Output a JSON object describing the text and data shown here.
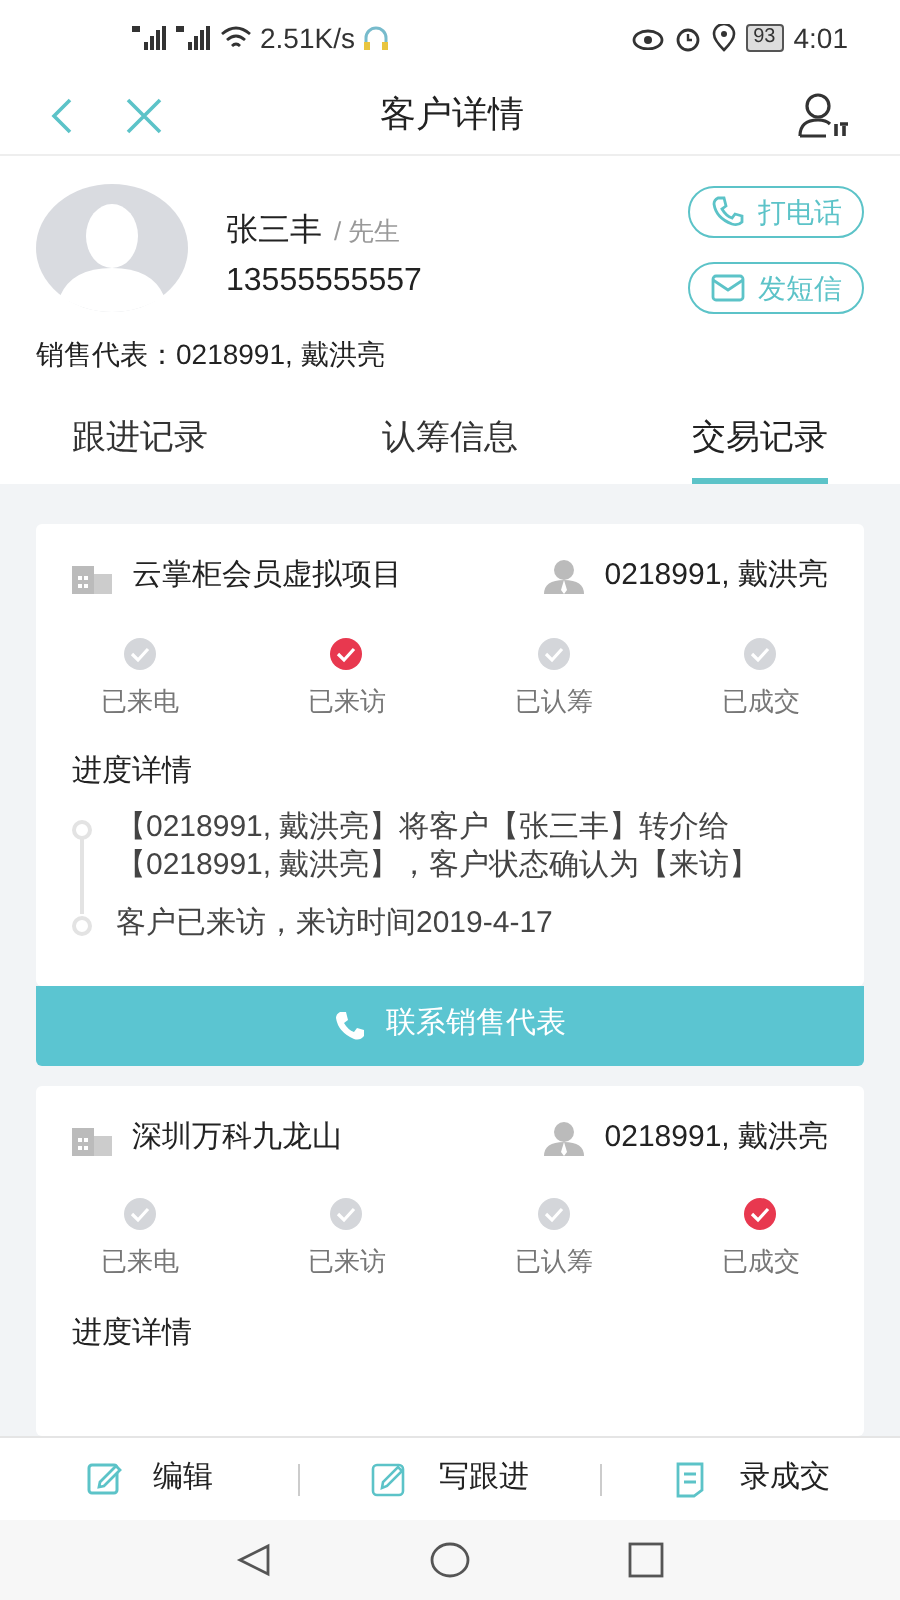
{
  "status_bar": {
    "speed": "2.51K/s",
    "battery": "93",
    "time": "4:01"
  },
  "header": {
    "title": "客户详情"
  },
  "customer": {
    "name": "张三丰",
    "title": "/ 先生",
    "phone": "13555555557",
    "sales_rep": "销售代表：0218991, 戴洪亮"
  },
  "actions": [
    {
      "kind": "call",
      "label": "打电话"
    },
    {
      "kind": "sms",
      "label": "发短信"
    }
  ],
  "tabs": [
    {
      "label": "跟进记录",
      "selected": false
    },
    {
      "label": "认筹信息",
      "selected": false
    },
    {
      "label": "交易记录",
      "selected": true
    }
  ],
  "records": [
    {
      "project": "云掌柜会员虚拟项目",
      "agent": "0218991, 戴洪亮",
      "steps": [
        {
          "label": "已来电",
          "checked": false
        },
        {
          "label": "已来访",
          "checked": true
        },
        {
          "label": "已认筹",
          "checked": false
        },
        {
          "label": "已成交",
          "checked": false
        }
      ],
      "progress_title": "进度详情",
      "progress": [
        "【0218991, 戴洪亮】将客户【张三丰】转介给【0218991, 戴洪亮】，客户状态确认为【来访】",
        "客户已来访，来访时间2019-4-17"
      ],
      "contact_button": "联系销售代表"
    },
    {
      "project": "深圳万科九龙山",
      "agent": "0218991, 戴洪亮",
      "steps": [
        {
          "label": "已来电",
          "checked": false
        },
        {
          "label": "已来访",
          "checked": false
        },
        {
          "label": "已认筹",
          "checked": false
        },
        {
          "label": "已成交",
          "checked": true
        }
      ],
      "progress_title": "进度详情"
    }
  ],
  "bottom_bar": [
    {
      "kind": "edit",
      "label": "编辑"
    },
    {
      "kind": "follow",
      "label": "写跟进"
    },
    {
      "kind": "deal",
      "label": "录成交"
    }
  ]
}
